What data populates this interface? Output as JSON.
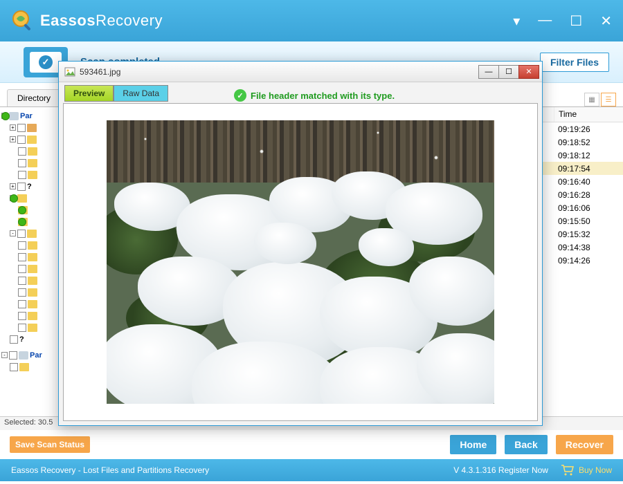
{
  "brand": {
    "bold": "Eassos",
    "light": "Recovery"
  },
  "status": {
    "text": "Scan completed",
    "filter_btn": "Filter Files"
  },
  "main_tabs": {
    "directory": "Directory",
    "par_label": "Par"
  },
  "table": {
    "time_header": "Time",
    "rows": [
      {
        "time": "09:19:26"
      },
      {
        "time": "09:18:52"
      },
      {
        "time": "09:18:12"
      },
      {
        "time": "09:17:54",
        "selected": true
      },
      {
        "time": "09:16:40"
      },
      {
        "time": "09:16:28"
      },
      {
        "time": "09:16:06"
      },
      {
        "time": "09:15:50"
      },
      {
        "time": "09:15:32"
      },
      {
        "time": "09:14:38"
      },
      {
        "time": "09:14:26"
      }
    ]
  },
  "selected_text": "Selected: 30.5",
  "footer": {
    "save": "Save Scan Status",
    "home": "Home",
    "back": "Back",
    "recover": "Recover"
  },
  "statusbar": {
    "left": "Eassos Recovery - Lost Files and Partitions Recovery",
    "version": "V 4.3.1.316  Register Now",
    "buy": "Buy Now"
  },
  "preview": {
    "title": "593461.jpg",
    "tab_preview": "Preview",
    "tab_raw": "Raw Data",
    "status_msg": "File header matched with its type."
  }
}
